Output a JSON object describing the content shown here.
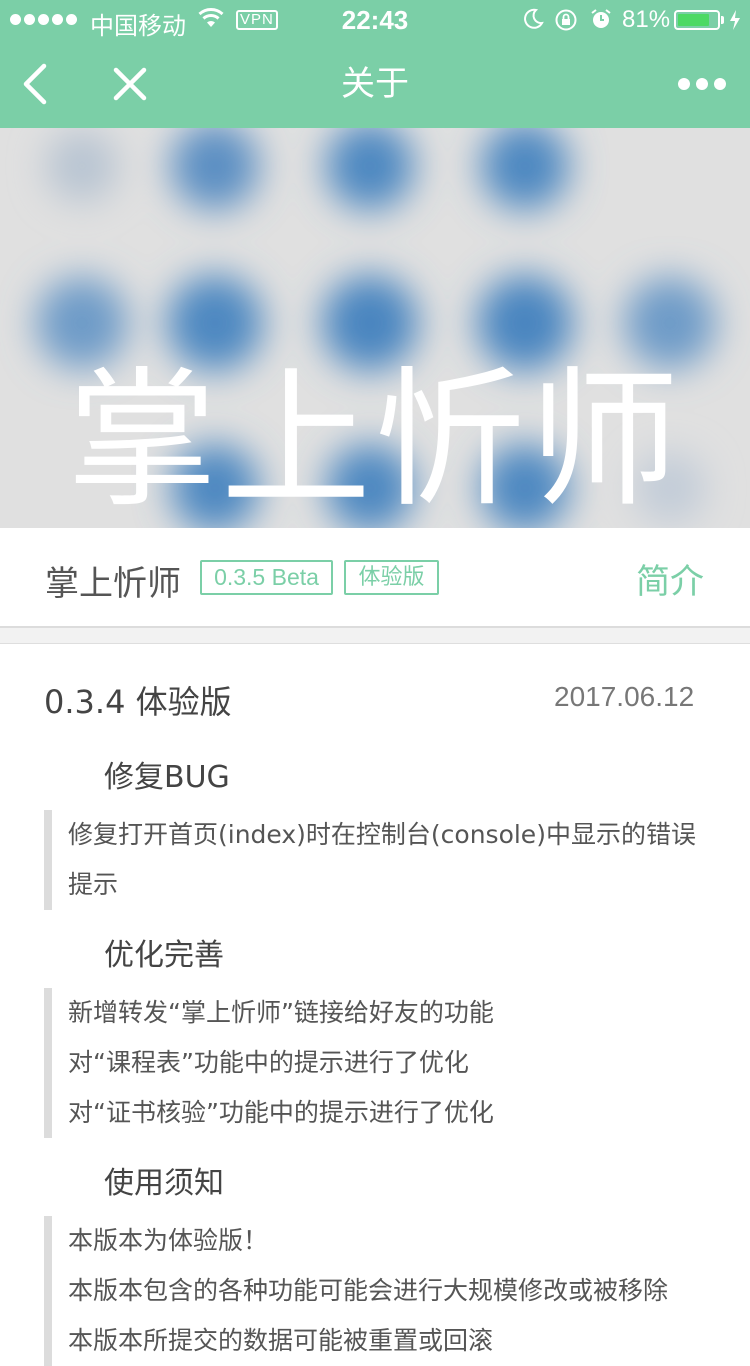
{
  "status_bar": {
    "carrier": "中国移动",
    "vpn": "VPN",
    "time": "22:43",
    "battery_percent": "81%",
    "battery_level": 0.81,
    "battery_color": "#4cd964"
  },
  "nav": {
    "title": "关于",
    "back_icon": "chevron-left-icon",
    "close_icon": "close-icon",
    "more_icon": "more-dots-icon",
    "background": "#7bcfa7"
  },
  "banner": {
    "title": "掌上忻师"
  },
  "app_info": {
    "name": "掌上忻师",
    "version_tag": "0.3.5 Beta",
    "channel_tag": "体验版",
    "intro_link": "简介",
    "accent": "#7bcfa7"
  },
  "release": {
    "title": "0.3.4 体验版",
    "date": "2017.06.12",
    "sections": [
      {
        "title": "修复BUG",
        "items": [
          "修复打开首页(index)时在控制台(console)中显示的错误",
          "提示"
        ]
      },
      {
        "title": "优化完善",
        "items": [
          "新增转发“掌上忻师”链接给好友的功能",
          "对“课程表”功能中的提示进行了优化",
          "对“证书核验”功能中的提示进行了优化"
        ]
      },
      {
        "title": "使用须知",
        "items": [
          "本版本为体验版！",
          "本版本包含的各种功能可能会进行大规模修改或被移除",
          "本版本所提交的数据可能被重置或回滚"
        ]
      }
    ]
  }
}
